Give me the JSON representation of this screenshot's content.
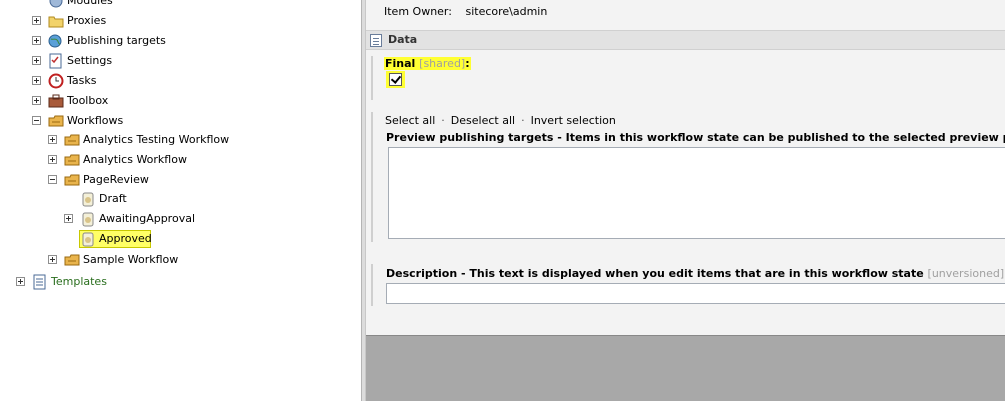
{
  "tree": {
    "modules": "Modules",
    "proxies": "Proxies",
    "publishing_targets": "Publishing targets",
    "settings": "Settings",
    "tasks": "Tasks",
    "toolbox": "Toolbox",
    "workflows": "Workflows",
    "analytics_testing_workflow": "Analytics Testing Workflow",
    "analytics_workflow": "Analytics Workflow",
    "page_review": "PageReview",
    "draft": "Draft",
    "awaiting_approval": "AwaitingApproval",
    "approved": "Approved",
    "sample_workflow": "Sample Workflow",
    "templates": "Templates"
  },
  "content": {
    "item_owner_label": "Item Owner:",
    "item_owner_value": "sitecore\\admin",
    "section_title": "Data",
    "final_label": "Final",
    "final_tag": "[shared]",
    "final_colon": ":",
    "select_all": "Select all",
    "deselect_all": "Deselect all",
    "invert_selection": "Invert selection",
    "link_sep": "·",
    "preview_label": "Preview publishing targets - Items in this workflow state can be published to the selected preview publishing t",
    "description_label": "Description - This text is displayed when you edit items that are in this workflow state",
    "description_tag": "[unversioned]",
    "description_colon": ":"
  },
  "colors": {
    "highlight": "#ffff33",
    "tree_selected": "#ffff66",
    "templates_text": "#2a6e1e"
  }
}
